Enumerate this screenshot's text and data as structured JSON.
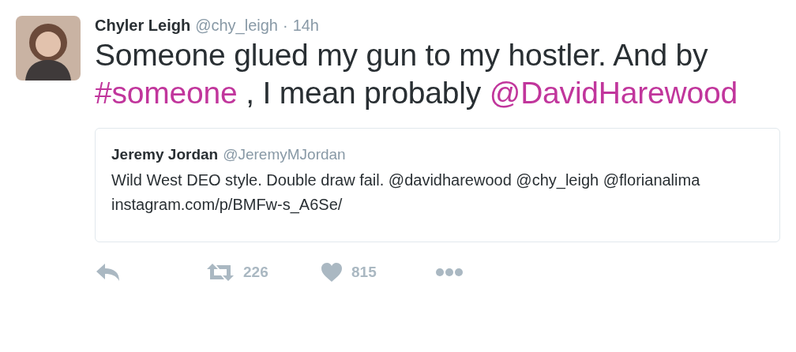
{
  "tweet": {
    "name": "Chyler Leigh",
    "handle": "@chy_leigh",
    "separator": "·",
    "time": "14h",
    "text": [
      {
        "kind": "text",
        "text": "Someone glued my gun to my hostler. And by "
      },
      {
        "kind": "hashtag",
        "text": "#someone"
      },
      {
        "kind": "text",
        "text": " , I mean probably "
      },
      {
        "kind": "mention",
        "text": "@DavidHarewood"
      }
    ],
    "quote": {
      "name": "Jeremy Jordan",
      "handle": "@JeremyMJordan",
      "text": "Wild West DEO style. Double draw fail. @davidharewood @chy_leigh @florianalima instagram.com/p/BMFw-s_A6Se/"
    },
    "actions": [
      {
        "kind": "reply"
      },
      {
        "kind": "retweet",
        "count": "226"
      },
      {
        "kind": "like",
        "count": "815"
      },
      {
        "kind": "more"
      }
    ]
  }
}
